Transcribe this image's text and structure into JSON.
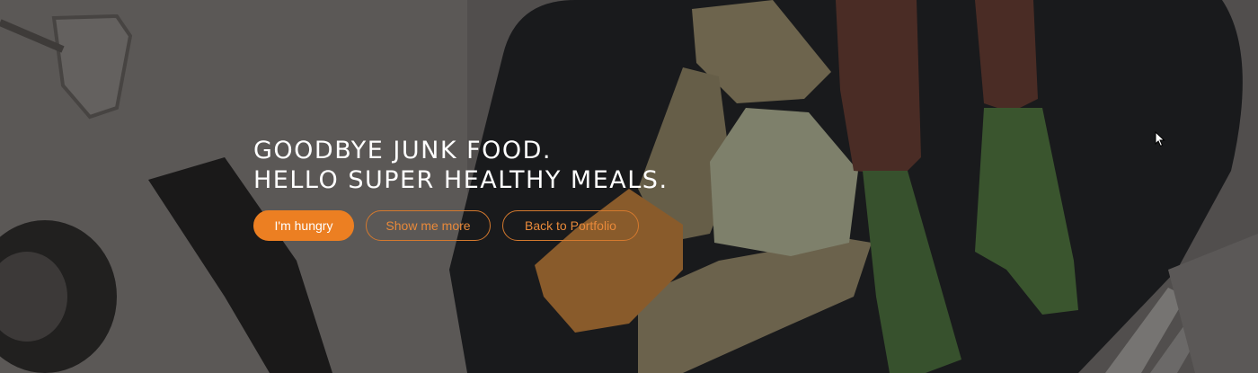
{
  "hero": {
    "headline": [
      "GOODBYE JUNK FOOD.",
      "HELLO SUPER HEALTHY MEALS."
    ],
    "buttons": {
      "primary": "I'm hungry",
      "more": "Show me more",
      "back": "Back to Portfolio"
    },
    "colors": {
      "accent": "#ec7f22",
      "outline_text": "#e8893a",
      "headline": "#ffffff"
    }
  },
  "icons": {
    "cursor": "mouse-pointer-icon"
  }
}
